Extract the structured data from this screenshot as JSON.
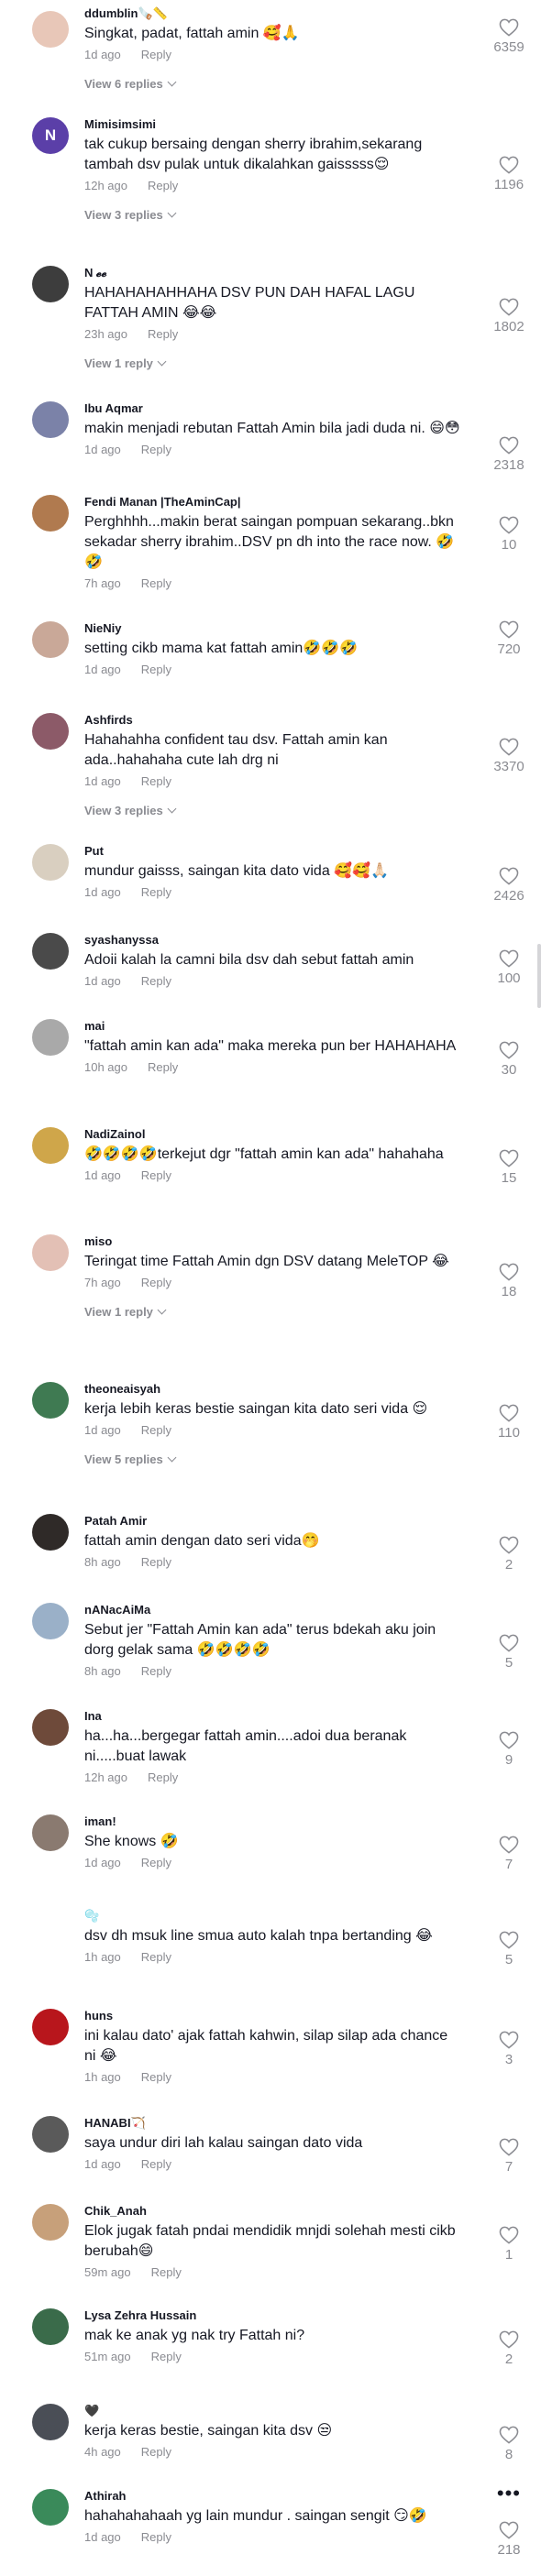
{
  "comments": [
    {
      "user": "ddumblin🪚📏",
      "text": "Singkat, padat, fattah amin 🥰🙏",
      "time": "1d ago",
      "reply": "Reply",
      "likes": "6359",
      "view_replies": "View 6 replies",
      "avatar_color": "#e8c7b8"
    },
    {
      "user": "Mimisimsimi",
      "text": "tak cukup bersaing dengan sherry ibrahim,sekarang tambah dsv pulak untuk dikalahkan gaisssss😌",
      "time": "12h ago",
      "reply": "Reply",
      "likes": "1196",
      "view_replies": "View 3 replies",
      "avatar_color": "#5b3fa8",
      "avatar_letter": "N"
    },
    {
      "user": "N 𝓮𝓮",
      "text": "HAHAHAHAHHAHA DSV PUN DAH HAFAL LAGU FATTAH AMIN 😂😂",
      "time": "23h ago",
      "reply": "Reply",
      "likes": "1802",
      "view_replies": "View 1 reply",
      "avatar_color": "#3d3d3d"
    },
    {
      "user": "Ibu Aqmar",
      "text": "makin menjadi rebutan Fattah Amin bila jadi duda ni. 😄😳",
      "time": "1d ago",
      "reply": "Reply",
      "likes": "2318",
      "avatar_color": "#7b82a8"
    },
    {
      "user": "Fendi Manan |TheAminCap|",
      "text": "Perghhhh...makin berat saingan pompuan sekarang..bkn sekadar sherry ibrahim..DSV pn dh into the race now. 🤣🤣",
      "time": "7h ago",
      "reply": "Reply",
      "likes": "10",
      "avatar_color": "#b07a4f"
    },
    {
      "user": "NieNiy",
      "text": "setting cikb mama kat fattah amin🤣🤣🤣",
      "time": "1d ago",
      "reply": "Reply",
      "likes": "720",
      "avatar_color": "#c9a898"
    },
    {
      "user": "Ashfirds",
      "text": "Hahahahha confident tau dsv. Fattah amin kan ada..hahahaha cute lah drg ni",
      "time": "1d ago",
      "reply": "Reply",
      "likes": "3370",
      "view_replies": "View 3 replies",
      "avatar_color": "#8c5a68"
    },
    {
      "user": "Put",
      "text": "mundur gaisss, saingan kita dato vida 🥰🥰🙏🏻",
      "time": "1d ago",
      "reply": "Reply",
      "likes": "2426",
      "avatar_color": "#d9cfc0"
    },
    {
      "user": "syashanyssa",
      "text": "Adoii kalah la camni bila dsv dah sebut fattah amin",
      "time": "1d ago",
      "reply": "Reply",
      "likes": "100",
      "avatar_color": "#4a4a4a"
    },
    {
      "user": "mai",
      "text": "\"fattah amin kan ada\" maka mereka pun ber HAHAHAHA",
      "time": "10h ago",
      "reply": "Reply",
      "likes": "30",
      "avatar_color": "#a9a9a9"
    },
    {
      "user": "NadiZainol",
      "text": "🤣🤣🤣🤣terkejut dgr \"fattah amin kan ada\" hahahaha",
      "time": "1d ago",
      "reply": "Reply",
      "likes": "15",
      "avatar_color": "#cfa64a"
    },
    {
      "user": "miso",
      "text": "Teringat time Fattah Amin dgn DSV datang MeleTOP 😂",
      "time": "7h ago",
      "reply": "Reply",
      "likes": "18",
      "view_replies": "View 1 reply",
      "avatar_color": "#e3c0b5"
    },
    {
      "user": "theoneaisyah",
      "text": "kerja lebih keras bestie saingan kita dato seri vida 😌",
      "time": "1d ago",
      "reply": "Reply",
      "likes": "110",
      "view_replies": "View 5 replies",
      "avatar_color": "#3f7a52"
    },
    {
      "user": "Patah Amir",
      "text": "fattah amin dengan dato seri vida🤭",
      "time": "8h ago",
      "reply": "Reply",
      "likes": "2",
      "avatar_color": "#2f2a28"
    },
    {
      "user": "nANacAiMa",
      "text": "Sebut jer \"Fattah Amin kan ada\" terus bdekah aku join dorg gelak sama 🤣🤣🤣🤣",
      "time": "8h ago",
      "reply": "Reply",
      "likes": "5",
      "avatar_color": "#9ab0c8"
    },
    {
      "user": "Ina",
      "text": "ha...ha...bergegar fattah amin....adoi dua beranak ni.....buat lawak",
      "time": "12h ago",
      "reply": "Reply",
      "likes": "9",
      "avatar_color": "#6e4a3a"
    },
    {
      "user": "iman!",
      "text": "She knows 🤣",
      "time": "1d ago",
      "reply": "Reply",
      "likes": "7",
      "avatar_color": "#8a7a70"
    },
    {
      "user": "🫧",
      "text": "dsv dh msuk line smua auto kalah tnpa bertanding 😂",
      "time": "1h ago",
      "reply": "Reply",
      "likes": "5",
      "avatar_color": "#ffffff"
    },
    {
      "user": "huns",
      "text": "ini kalau dato' ajak fattah kahwin, silap silap ada chance ni 😂",
      "time": "1h ago",
      "reply": "Reply",
      "likes": "3",
      "avatar_color": "#b8161c"
    },
    {
      "user": "HANABI🏹",
      "text": "saya undur diri lah kalau saingan dato vida",
      "time": "1d ago",
      "reply": "Reply",
      "likes": "7",
      "avatar_color": "#5a5a5a"
    },
    {
      "user": "Chik_Anah",
      "text": "Elok jugak fatah pndai mendidik mnjdi solehah mesti cikb berubah😄",
      "time": "59m ago",
      "reply": "Reply",
      "likes": "1",
      "avatar_color": "#c7a07a"
    },
    {
      "user": "Lysa Zehra Hussain",
      "text": "mak ke anak yg nak try Fattah ni?",
      "time": "51m ago",
      "reply": "Reply",
      "likes": "2",
      "avatar_color": "#3a6b4a"
    },
    {
      "user": "🖤",
      "text": "kerja keras bestie, saingan kita dsv 😒",
      "time": "4h ago",
      "reply": "Reply",
      "likes": "8",
      "avatar_color": "#4a4e56"
    },
    {
      "user": "Athirah",
      "text": "hahahahahaah yg lain mundur . saingan sengit 😏🤣",
      "time": "1d ago",
      "reply": "Reply",
      "likes": "218",
      "avatar_color": "#3a8a5a",
      "more": "•••"
    }
  ],
  "colors": {
    "text": "#161823",
    "muted": "#8a8b91",
    "background": "#ffffff"
  },
  "icons": {
    "like": "heart-outline-icon",
    "expand": "chevron-down-icon",
    "more": "more-icon"
  }
}
